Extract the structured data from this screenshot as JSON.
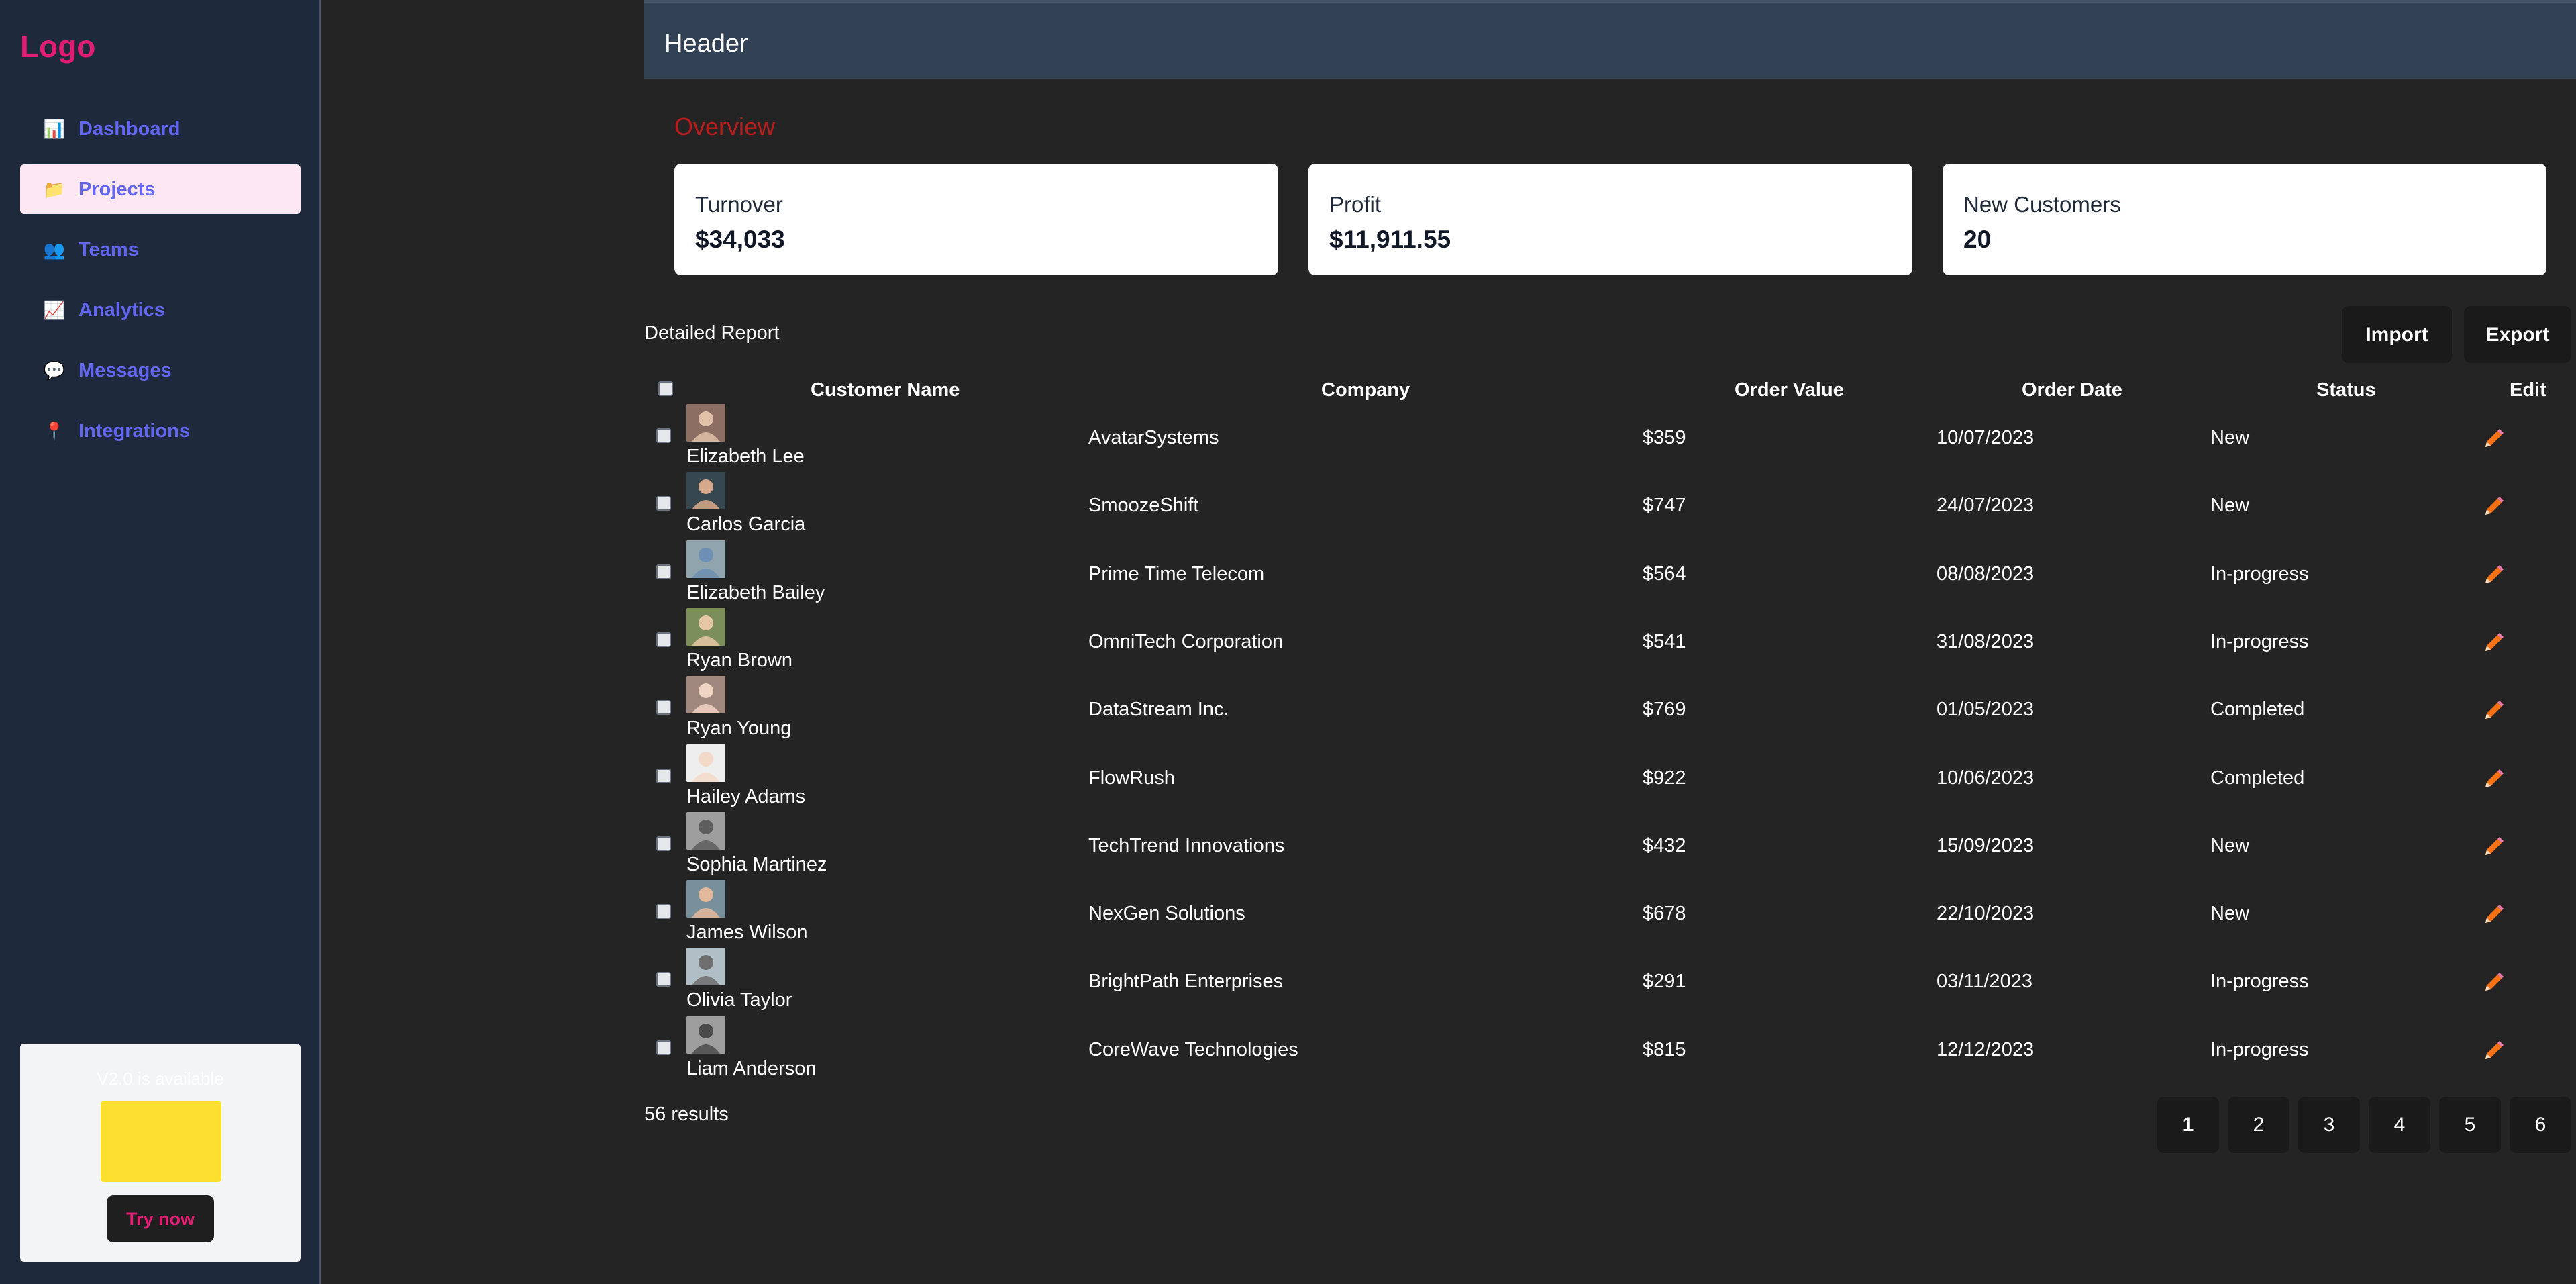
{
  "sidebar": {
    "logo": "Logo",
    "items": [
      {
        "label": "Dashboard",
        "icon": "bar-chart-icon",
        "glyph": "📊"
      },
      {
        "label": "Projects",
        "icon": "folder-icon",
        "glyph": "📁"
      },
      {
        "label": "Teams",
        "icon": "people-icon",
        "glyph": "👥"
      },
      {
        "label": "Analytics",
        "icon": "line-chart-icon",
        "glyph": "📈"
      },
      {
        "label": "Messages",
        "icon": "speech-bubble-icon",
        "glyph": "💬"
      },
      {
        "label": "Integrations",
        "icon": "pin-icon",
        "glyph": "📍"
      }
    ],
    "active_index": 1,
    "promo": {
      "text": "V2.0 is available",
      "button": "Try now"
    }
  },
  "header": {
    "title": "Header"
  },
  "overview": {
    "title": "Overview",
    "cards": [
      {
        "label": "Turnover",
        "value": "$34,033"
      },
      {
        "label": "Profit",
        "value": "$11,911.55"
      },
      {
        "label": "New Customers",
        "value": "20"
      }
    ]
  },
  "report": {
    "title": "Detailed Report",
    "import_label": "Import",
    "export_label": "Export",
    "columns": [
      "Customer Name",
      "Company",
      "Order Value",
      "Order Date",
      "Status",
      "Edit"
    ],
    "rows": [
      {
        "name": "Elizabeth Lee",
        "company": "AvatarSystems",
        "value": "$359",
        "date": "10/07/2023",
        "status": "New"
      },
      {
        "name": "Carlos Garcia",
        "company": "SmoozeShift",
        "value": "$747",
        "date": "24/07/2023",
        "status": "New"
      },
      {
        "name": "Elizabeth Bailey",
        "company": "Prime Time Telecom",
        "value": "$564",
        "date": "08/08/2023",
        "status": "In-progress"
      },
      {
        "name": "Ryan Brown",
        "company": "OmniTech Corporation",
        "value": "$541",
        "date": "31/08/2023",
        "status": "In-progress"
      },
      {
        "name": "Ryan Young",
        "company": "DataStream Inc.",
        "value": "$769",
        "date": "01/05/2023",
        "status": "Completed"
      },
      {
        "name": "Hailey Adams",
        "company": "FlowRush",
        "value": "$922",
        "date": "10/06/2023",
        "status": "Completed"
      },
      {
        "name": "Sophia Martinez",
        "company": "TechTrend Innovations",
        "value": "$432",
        "date": "15/09/2023",
        "status": "New"
      },
      {
        "name": "James Wilson",
        "company": "NexGen Solutions",
        "value": "$678",
        "date": "22/10/2023",
        "status": "New"
      },
      {
        "name": "Olivia Taylor",
        "company": "BrightPath Enterprises",
        "value": "$291",
        "date": "03/11/2023",
        "status": "In-progress"
      },
      {
        "name": "Liam Anderson",
        "company": "CoreWave Technologies",
        "value": "$815",
        "date": "12/12/2023",
        "status": "In-progress"
      }
    ],
    "results": "56 results",
    "pages": [
      "1",
      "2",
      "3",
      "4",
      "5",
      "6"
    ],
    "current_page": "1"
  },
  "colors": {
    "accent": "#e11d74",
    "nav_text": "#6366f1",
    "overview_title": "#b91c1c",
    "edit_icon": "#f97316"
  }
}
